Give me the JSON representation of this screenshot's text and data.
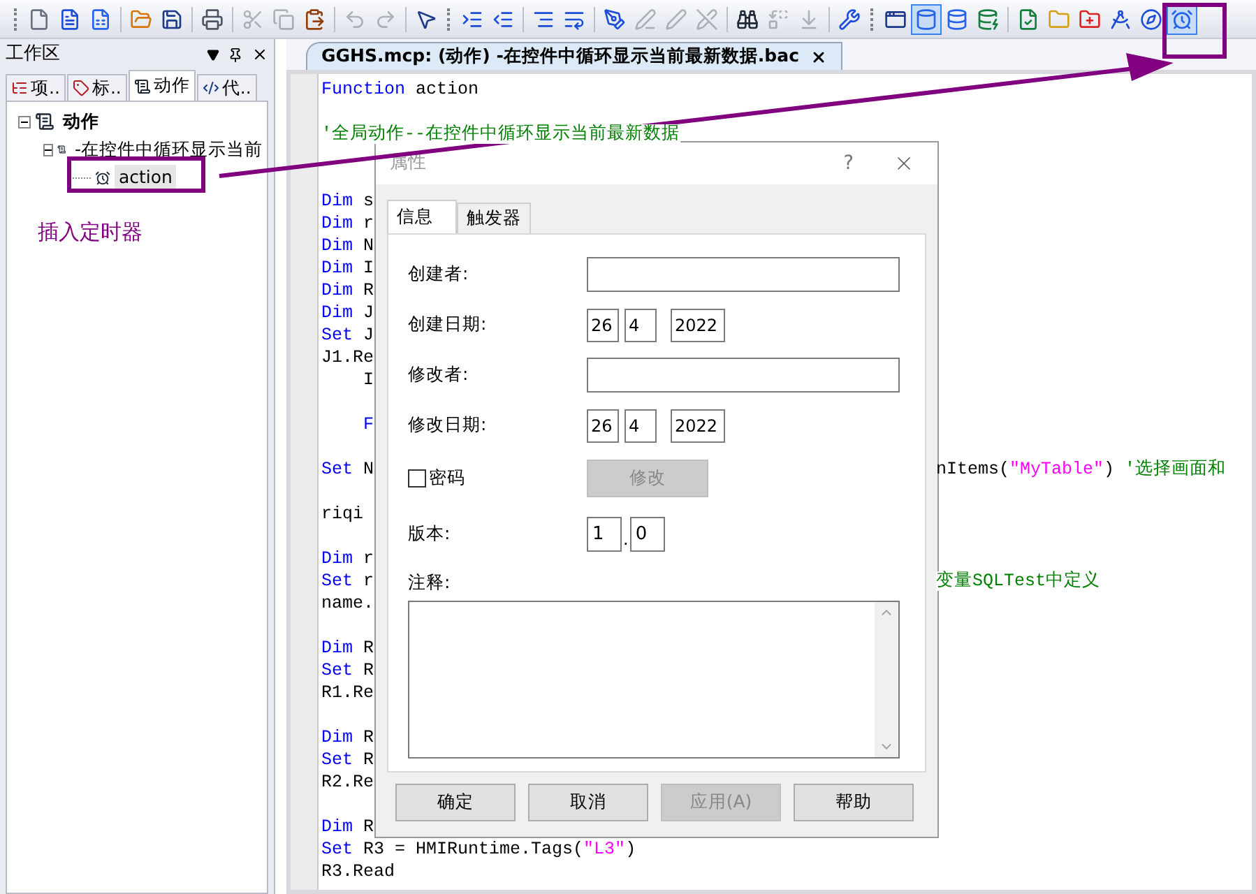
{
  "toolbar": [
    {
      "kind": "grip"
    },
    {
      "kind": "new-file",
      "disabled": false,
      "pressed": false
    },
    {
      "kind": "document",
      "disabled": false,
      "pressed": false
    },
    {
      "kind": "document-blue",
      "disabled": false,
      "pressed": false
    },
    {
      "kind": "separator"
    },
    {
      "kind": "open-folder",
      "disabled": false,
      "pressed": false
    },
    {
      "kind": "save",
      "disabled": false,
      "pressed": false
    },
    {
      "kind": "separator"
    },
    {
      "kind": "print",
      "disabled": false,
      "pressed": false
    },
    {
      "kind": "separator"
    },
    {
      "kind": "cut",
      "disabled": true,
      "pressed": false
    },
    {
      "kind": "copy",
      "disabled": true,
      "pressed": false
    },
    {
      "kind": "paste",
      "disabled": false,
      "pressed": false
    },
    {
      "kind": "separator"
    },
    {
      "kind": "undo",
      "disabled": true,
      "pressed": false
    },
    {
      "kind": "redo",
      "disabled": true,
      "pressed": false
    },
    {
      "kind": "separator"
    },
    {
      "kind": "help-pointer",
      "disabled": false,
      "pressed": false
    },
    {
      "kind": "grip"
    },
    {
      "kind": "indent",
      "disabled": false,
      "pressed": false
    },
    {
      "kind": "outdent",
      "disabled": false,
      "pressed": false
    },
    {
      "kind": "separator"
    },
    {
      "kind": "align",
      "disabled": false,
      "pressed": false
    },
    {
      "kind": "wrap",
      "disabled": false,
      "pressed": false
    },
    {
      "kind": "separator"
    },
    {
      "kind": "pen",
      "disabled": false,
      "pressed": false
    },
    {
      "kind": "pen-line",
      "disabled": true,
      "pressed": false
    },
    {
      "kind": "pen-tool",
      "disabled": true,
      "pressed": false
    },
    {
      "kind": "pen-off",
      "disabled": true,
      "pressed": false
    },
    {
      "kind": "separator"
    },
    {
      "kind": "binoculars",
      "disabled": false,
      "pressed": false
    },
    {
      "kind": "replace",
      "disabled": true,
      "pressed": false
    },
    {
      "kind": "find-next",
      "disabled": true,
      "pressed": false
    },
    {
      "kind": "separator"
    },
    {
      "kind": "wrench",
      "disabled": false,
      "pressed": false
    },
    {
      "kind": "grip"
    },
    {
      "kind": "window",
      "disabled": false,
      "pressed": false
    },
    {
      "kind": "cylinder",
      "disabled": false,
      "pressed": true
    },
    {
      "kind": "database",
      "disabled": false,
      "pressed": false
    },
    {
      "kind": "database-check",
      "disabled": false,
      "pressed": false
    },
    {
      "kind": "separator"
    },
    {
      "kind": "file-check",
      "disabled": false,
      "pressed": false
    },
    {
      "kind": "folder",
      "disabled": false,
      "pressed": false
    },
    {
      "kind": "folder-plus",
      "disabled": false,
      "pressed": false
    },
    {
      "kind": "compass",
      "disabled": false,
      "pressed": false
    },
    {
      "kind": "compass-alt",
      "disabled": false,
      "pressed": false
    },
    {
      "kind": "alarm-clock",
      "disabled": false,
      "pressed": true
    }
  ],
  "workspace": {
    "title": "工作区",
    "tabs": [
      {
        "kind": "project",
        "label": "项..",
        "selected": false
      },
      {
        "kind": "tags",
        "label": "标..",
        "selected": false
      },
      {
        "kind": "actions",
        "label": "动作",
        "selected": true
      },
      {
        "kind": "code",
        "label": "代..",
        "selected": false
      }
    ],
    "tree": [
      {
        "label": "动作",
        "expanded": true,
        "selected": false,
        "children": [
          {
            "label": "-在控件中循环显示当前",
            "expanded": true,
            "selected": false,
            "children": [
              {
                "label": "action",
                "selected": true
              }
            ]
          }
        ]
      }
    ]
  },
  "annotation": {
    "text": "插入定时器"
  },
  "editor": {
    "tab": {
      "title": "GGHS.mcp: (动作) -在控件中循环显示当前最新数据.bac",
      "selected": true
    },
    "lines": [
      {
        "kind": "code",
        "left": [
          {
            "kind": "keyword",
            "text": "Function"
          },
          {
            "kind": "plain",
            "text": " action"
          }
        ]
      },
      {
        "kind": "blank"
      },
      {
        "kind": "code",
        "left": [
          {
            "kind": "comment",
            "text": "'全局动作--在控件中循环显示当前最新数据"
          }
        ]
      },
      {
        "kind": "blank"
      },
      {
        "kind": "blank"
      },
      {
        "kind": "code",
        "left": [
          {
            "kind": "keyword",
            "text": "Dim"
          },
          {
            "kind": "plain",
            "text": " s"
          }
        ]
      },
      {
        "kind": "code",
        "left": [
          {
            "kind": "keyword",
            "text": "Dim"
          },
          {
            "kind": "plain",
            "text": " r"
          }
        ]
      },
      {
        "kind": "code",
        "left": [
          {
            "kind": "keyword",
            "text": "Dim"
          },
          {
            "kind": "plain",
            "text": " N"
          }
        ]
      },
      {
        "kind": "code",
        "left": [
          {
            "kind": "keyword",
            "text": "Dim"
          },
          {
            "kind": "plain",
            "text": " I"
          }
        ]
      },
      {
        "kind": "code",
        "left": [
          {
            "kind": "keyword",
            "text": "Dim"
          },
          {
            "kind": "plain",
            "text": " R"
          }
        ]
      },
      {
        "kind": "code",
        "left": [
          {
            "kind": "keyword",
            "text": "Dim"
          },
          {
            "kind": "plain",
            "text": " J"
          }
        ]
      },
      {
        "kind": "code",
        "left": [
          {
            "kind": "keyword",
            "text": "Set"
          },
          {
            "kind": "plain",
            "text": " J"
          }
        ]
      },
      {
        "kind": "code",
        "left": [
          {
            "kind": "plain",
            "text": "J1.Re"
          }
        ]
      },
      {
        "kind": "code",
        "left": [
          {
            "kind": "plain",
            "text": "    I"
          }
        ]
      },
      {
        "kind": "blank"
      },
      {
        "kind": "code",
        "left": [
          {
            "kind": "keyword",
            "text": "    F"
          }
        ]
      },
      {
        "kind": "blank"
      },
      {
        "kind": "code",
        "left": [
          {
            "kind": "keyword",
            "text": "Set"
          },
          {
            "kind": "plain",
            "text": " N"
          }
        ],
        "right": [
          {
            "kind": "plain",
            "text": "nItems("
          },
          {
            "kind": "string",
            "text": "\"MyTable\""
          },
          {
            "kind": "plain",
            "text": ") "
          },
          {
            "kind": "comment",
            "text": "'选择画面和"
          }
        ]
      },
      {
        "kind": "blank"
      },
      {
        "kind": "code",
        "left": [
          {
            "kind": "plain",
            "text": "riqi"
          }
        ]
      },
      {
        "kind": "blank"
      },
      {
        "kind": "code",
        "left": [
          {
            "kind": "keyword",
            "text": "Dim"
          },
          {
            "kind": "plain",
            "text": " r"
          }
        ]
      },
      {
        "kind": "code",
        "left": [
          {
            "kind": "keyword",
            "text": "Set"
          },
          {
            "kind": "plain",
            "text": " r"
          }
        ],
        "right": [
          {
            "kind": "comment",
            "text": "变量SQLTest中定义"
          }
        ]
      },
      {
        "kind": "code",
        "left": [
          {
            "kind": "plain",
            "text": "name."
          }
        ]
      },
      {
        "kind": "blank"
      },
      {
        "kind": "code",
        "left": [
          {
            "kind": "keyword",
            "text": "Dim"
          },
          {
            "kind": "plain",
            "text": " R"
          }
        ]
      },
      {
        "kind": "code",
        "left": [
          {
            "kind": "keyword",
            "text": "Set"
          },
          {
            "kind": "plain",
            "text": " R"
          }
        ]
      },
      {
        "kind": "code",
        "left": [
          {
            "kind": "plain",
            "text": "R1.Re"
          }
        ]
      },
      {
        "kind": "blank"
      },
      {
        "kind": "code",
        "left": [
          {
            "kind": "keyword",
            "text": "Dim"
          },
          {
            "kind": "plain",
            "text": " R"
          }
        ]
      },
      {
        "kind": "code",
        "left": [
          {
            "kind": "keyword",
            "text": "Set"
          },
          {
            "kind": "plain",
            "text": " R"
          }
        ]
      },
      {
        "kind": "code",
        "left": [
          {
            "kind": "plain",
            "text": "R2.Re"
          }
        ]
      },
      {
        "kind": "blank"
      },
      {
        "kind": "code",
        "left": [
          {
            "kind": "keyword",
            "text": "Dim"
          },
          {
            "kind": "plain",
            "text": " R"
          }
        ]
      },
      {
        "kind": "code",
        "left": [
          {
            "kind": "keyword",
            "text": "Set"
          },
          {
            "kind": "plain",
            "text": " R3 = HMIRuntime.Tags("
          },
          {
            "kind": "string",
            "text": "\"L3\""
          },
          {
            "kind": "plain",
            "text": ")"
          }
        ]
      },
      {
        "kind": "code",
        "left": [
          {
            "kind": "plain",
            "text": "R3.Read"
          }
        ]
      }
    ]
  },
  "dialog": {
    "title": "属性",
    "help": "?",
    "tabs": [
      {
        "label": "信息",
        "selected": true
      },
      {
        "label": "触发器",
        "selected": false
      }
    ],
    "fields": [
      {
        "kind": "text",
        "label": "创建者:"
      },
      {
        "kind": "date",
        "label": "创建日期:",
        "day": "26",
        "month": "4",
        "year": "2022"
      },
      {
        "kind": "text",
        "label": "修改者:"
      },
      {
        "kind": "date",
        "label": "修改日期:",
        "day": "26",
        "month": "4",
        "year": "2022"
      }
    ],
    "password": {
      "label": "密码",
      "checked": false,
      "button": {
        "label": "修改",
        "disabled": true
      }
    },
    "version": {
      "label": "版本:",
      "major": "1",
      "separator": ".",
      "minor": "0"
    },
    "notes": {
      "label": "注释:"
    },
    "buttons": [
      {
        "label": "确定",
        "disabled": false
      },
      {
        "label": "取消",
        "disabled": false
      },
      {
        "label": "应用(A)",
        "disabled": true
      },
      {
        "label": "帮助",
        "disabled": false
      }
    ]
  }
}
